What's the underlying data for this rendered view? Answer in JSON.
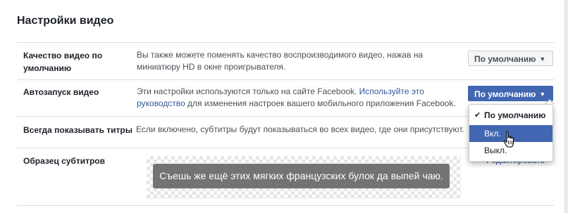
{
  "title": "Настройки видео",
  "rows": [
    {
      "label": "Качество видео по умолчанию",
      "description": "Вы также можете поменять качество воспроизводимого видео, нажав на миниатюру HD в окне проигрывателя.",
      "dropdown_value": "По умолчанию"
    },
    {
      "label": "Автозапуск видео",
      "description_before": "Эти настройки используются только на сайте Facebook. ",
      "description_link": "Используйте это руководство",
      "description_after": " для изменения настроек вашего мобильного приложения Facebook.",
      "dropdown_value": "По умолчанию",
      "menu": {
        "options": [
          "По умолчанию",
          "Вкл.",
          "Выкл."
        ],
        "selected": "По умолчанию",
        "hovered": "Вкл.",
        "check_icon": "checkmark-icon"
      }
    },
    {
      "label": "Всегда показывать титры",
      "description": "Если включено, субтитры будут показываться во всех видео, где они присутствуют."
    },
    {
      "label": "Образец субтитров",
      "sample_text": "Съешь же ещё этих мягких французских булок да выпей чаю.",
      "edit_link": "Редактировать"
    }
  ],
  "colors": {
    "accent": "#4267b2",
    "link": "#365899",
    "subtitle_bg": "#737373"
  },
  "icons": {
    "caret": "caret-down-icon",
    "cursor": "hand-pointer-icon"
  }
}
